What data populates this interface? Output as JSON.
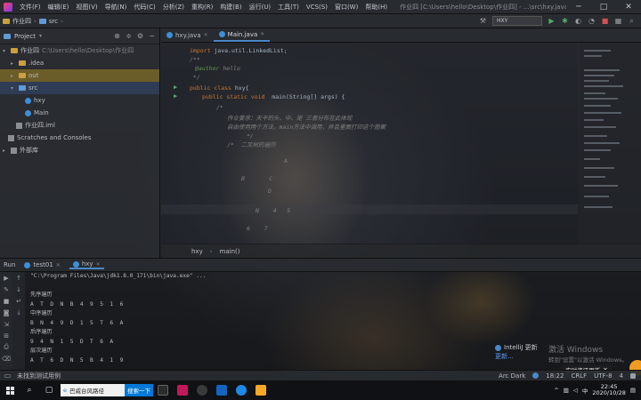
{
  "window": {
    "menu": [
      "文件(F)",
      "编辑(E)",
      "视图(V)",
      "导航(N)",
      "代码(C)",
      "分析(Z)",
      "重构(R)",
      "构建(B)",
      "运行(U)",
      "工具(T)",
      "VCS(S)",
      "窗口(W)",
      "帮助(H)"
    ],
    "title": "作业四 [C:\\Users\\hello\\Desktop\\作业四] - ...\\src\\hxy.java - IntelliJ IDEA",
    "controls": [
      "─",
      "□",
      "✕"
    ]
  },
  "nav": {
    "breadcrumb": [
      "作业四",
      "src"
    ],
    "run_config": "HXY"
  },
  "project_panel": {
    "title": "Project",
    "tree": [
      {
        "label": "作业四",
        "path": "C:\\Users\\hello\\Desktop\\作业四",
        "indent": 0
      },
      {
        "label": ".idea",
        "indent": 1
      },
      {
        "label": "out",
        "indent": 1
      },
      {
        "label": "src",
        "indent": 1
      },
      {
        "label": "hxy",
        "indent": 2
      },
      {
        "label": "Main",
        "indent": 2
      },
      {
        "label": "作业四.iml",
        "indent": 1
      },
      {
        "label": "Scratches and Consoles",
        "indent": 0
      },
      {
        "label": "外部库",
        "indent": 0
      }
    ]
  },
  "editor": {
    "tabs": [
      {
        "label": "hxy.java"
      },
      {
        "label": "Main.java"
      }
    ],
    "code": {
      "l1_kw": "import",
      "l1_rest": " java.util.LinkedList;",
      "l2": "/**",
      "l3_tag": "@author",
      "l3_rest": " hello",
      "l4": " */",
      "l5_kw": "public class",
      "l5_rest": " hxy{",
      "l6_kw": "public static void",
      "l6_rest": " main(String[] args) {",
      "l7": "/*",
      "l8": "作业要求：天干的头、中、尾 三者分布在此体现",
      "l9": "自由使用两个方法，main方法中调用，并且里面打印这个图案",
      "l10": "*/",
      "l11": "/*  二叉树的遍历",
      "l12": "A",
      "l13": "B       C",
      "l14": "D",
      "l15": "N    4   5",
      "l16": "6    7"
    },
    "breadcrumb": [
      "hxy",
      "main()"
    ]
  },
  "run_panel": {
    "label": "Run",
    "tabs": [
      "test01",
      "hxy"
    ],
    "console": [
      "\"C:\\Program Files\\Java\\jdk1.8.0_171\\bin\\java.exe\" ...",
      "",
      "先序遍历",
      "A  T  D  N  B  4  9  5  1  6",
      "中序遍历",
      "B  N  4  9  D  1  5  T  6  A",
      "后序遍历",
      "9  4  N  1  5  D  T  6  A",
      "层次遍历",
      "A  T  6  D  N  5  B  4  1  9"
    ]
  },
  "status": {
    "left": "未找到测试用例",
    "theme": "Arc Dark",
    "position": "18:22",
    "line_sep": "CRLF",
    "encoding": "UTF-8",
    "indent": "4"
  },
  "notification": {
    "title": "IntelliJ 更新",
    "link": "更新..."
  },
  "activation": {
    "title": "激活 Windows",
    "subtitle": "转到\"设置\"以激活 Windows。"
  },
  "toast": {
    "label": "实时资讯更新"
  },
  "taskbar": {
    "search_text": "巴威台风路径",
    "search_btn": "搜索一下",
    "time": "22:45",
    "date": "2020/10/28"
  }
}
